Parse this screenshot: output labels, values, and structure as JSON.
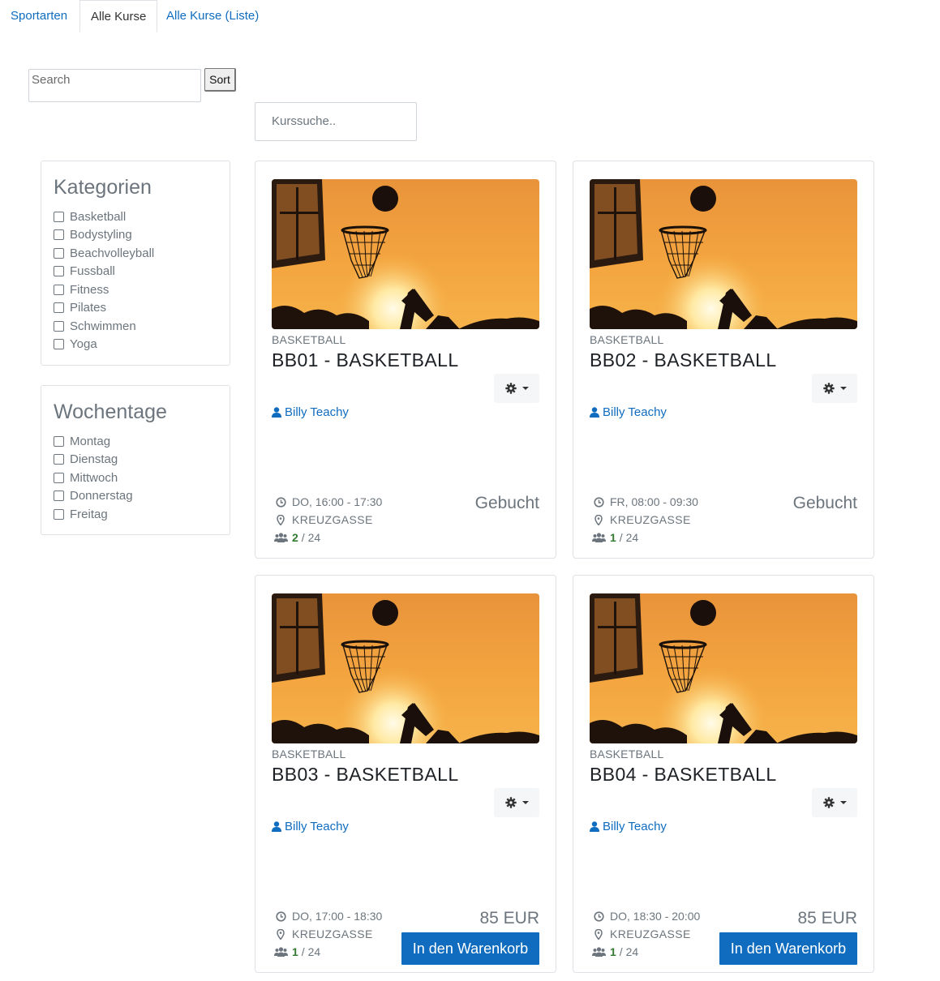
{
  "tabs": [
    {
      "label": "Sportarten"
    },
    {
      "label": "Alle Kurse"
    },
    {
      "label": "Alle Kurse (Liste)"
    }
  ],
  "search": {
    "placeholder": "Search",
    "sort_label": "Sort"
  },
  "course_search": {
    "placeholder": "Kurssuche.."
  },
  "categories": {
    "title": "Kategorien",
    "items": [
      "Basketball",
      "Bodystyling",
      "Beachvolleyball",
      "Fussball",
      "Fitness",
      "Pilates",
      "Schwimmen",
      "Yoga"
    ]
  },
  "weekdays": {
    "title": "Wochentage",
    "items": [
      "Montag",
      "Dienstag",
      "Mittwoch",
      "Donnerstag",
      "Freitag"
    ]
  },
  "courses": [
    {
      "category": "BASKETBALL",
      "title": "BB01 - BASKETBALL",
      "teacher": "Billy Teachy",
      "time": "DO, 16:00 - 17:30",
      "location": "KREUZGASSE",
      "booked": "2",
      "capacity": "/ 24",
      "status": "Gebucht",
      "price": "",
      "cart_label": ""
    },
    {
      "category": "BASKETBALL",
      "title": "BB02 - BASKETBALL",
      "teacher": "Billy Teachy",
      "time": "FR, 08:00 - 09:30",
      "location": "KREUZGASSE",
      "booked": "1",
      "capacity": "/ 24",
      "status": "Gebucht",
      "price": "",
      "cart_label": ""
    },
    {
      "category": "BASKETBALL",
      "title": "BB03 - BASKETBALL",
      "teacher": "Billy Teachy",
      "time": "DO, 17:00 - 18:30",
      "location": "KREUZGASSE",
      "booked": "1",
      "capacity": "/ 24",
      "status": "",
      "price": "85 EUR",
      "cart_label": "In den Warenkorb"
    },
    {
      "category": "BASKETBALL",
      "title": "BB04 - BASKETBALL",
      "teacher": "Billy Teachy",
      "time": "DO, 18:30 - 20:00",
      "location": "KREUZGASSE",
      "booked": "1",
      "capacity": "/ 24",
      "status": "",
      "price": "85 EUR",
      "cart_label": "In den Warenkorb"
    }
  ],
  "colors": {
    "link": "#0f6cbf",
    "muted": "#6c757d",
    "booked": "#357a32",
    "button": "#0f6cbf"
  },
  "icons": {
    "gear": "gear-icon",
    "user": "user-icon",
    "clock": "clock-icon",
    "location": "map-marker-icon",
    "group": "users-icon"
  }
}
